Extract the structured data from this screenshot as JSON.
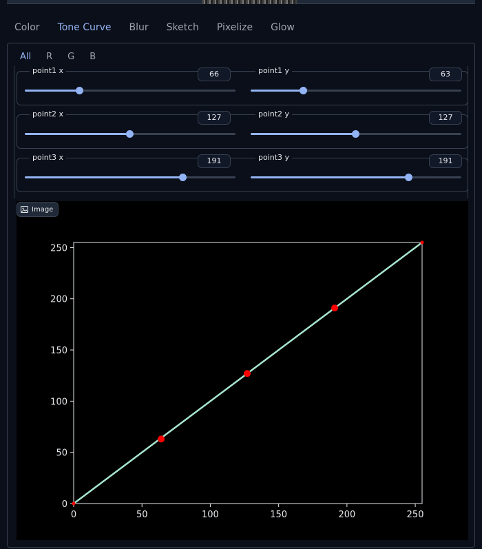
{
  "tabs": [
    "Color",
    "Tone Curve",
    "Blur",
    "Sketch",
    "Pixelize",
    "Glow"
  ],
  "active_tab": 1,
  "channels": [
    "All",
    "R",
    "G",
    "B"
  ],
  "active_channel": 0,
  "sliders": [
    [
      {
        "label": "point1 x",
        "value": "66",
        "fraction": 0.259
      },
      {
        "label": "point1 y",
        "value": "63",
        "fraction": 0.247
      }
    ],
    [
      {
        "label": "point2 x",
        "value": "127",
        "fraction": 0.498
      },
      {
        "label": "point2 y",
        "value": "127",
        "fraction": 0.498
      }
    ],
    [
      {
        "label": "point3 x",
        "value": "191",
        "fraction": 0.749
      },
      {
        "label": "point3 y",
        "value": "191",
        "fraction": 0.749
      }
    ]
  ],
  "image_label": "Image",
  "colors": {
    "accent": "#93b4f4",
    "curve": "#a8e6cf",
    "point": "#ff0000"
  },
  "chart_data": {
    "type": "line",
    "xlim": [
      0,
      255
    ],
    "ylim": [
      0,
      255
    ],
    "xticks": [
      0,
      50,
      100,
      150,
      200,
      250
    ],
    "yticks": [
      0,
      50,
      100,
      150,
      200,
      250
    ],
    "curve": {
      "x": [
        0,
        255
      ],
      "y": [
        0,
        255
      ]
    },
    "points": {
      "x": [
        0,
        64,
        127,
        191,
        255
      ],
      "y": [
        0,
        63,
        127,
        191,
        255
      ]
    },
    "grid": false
  }
}
